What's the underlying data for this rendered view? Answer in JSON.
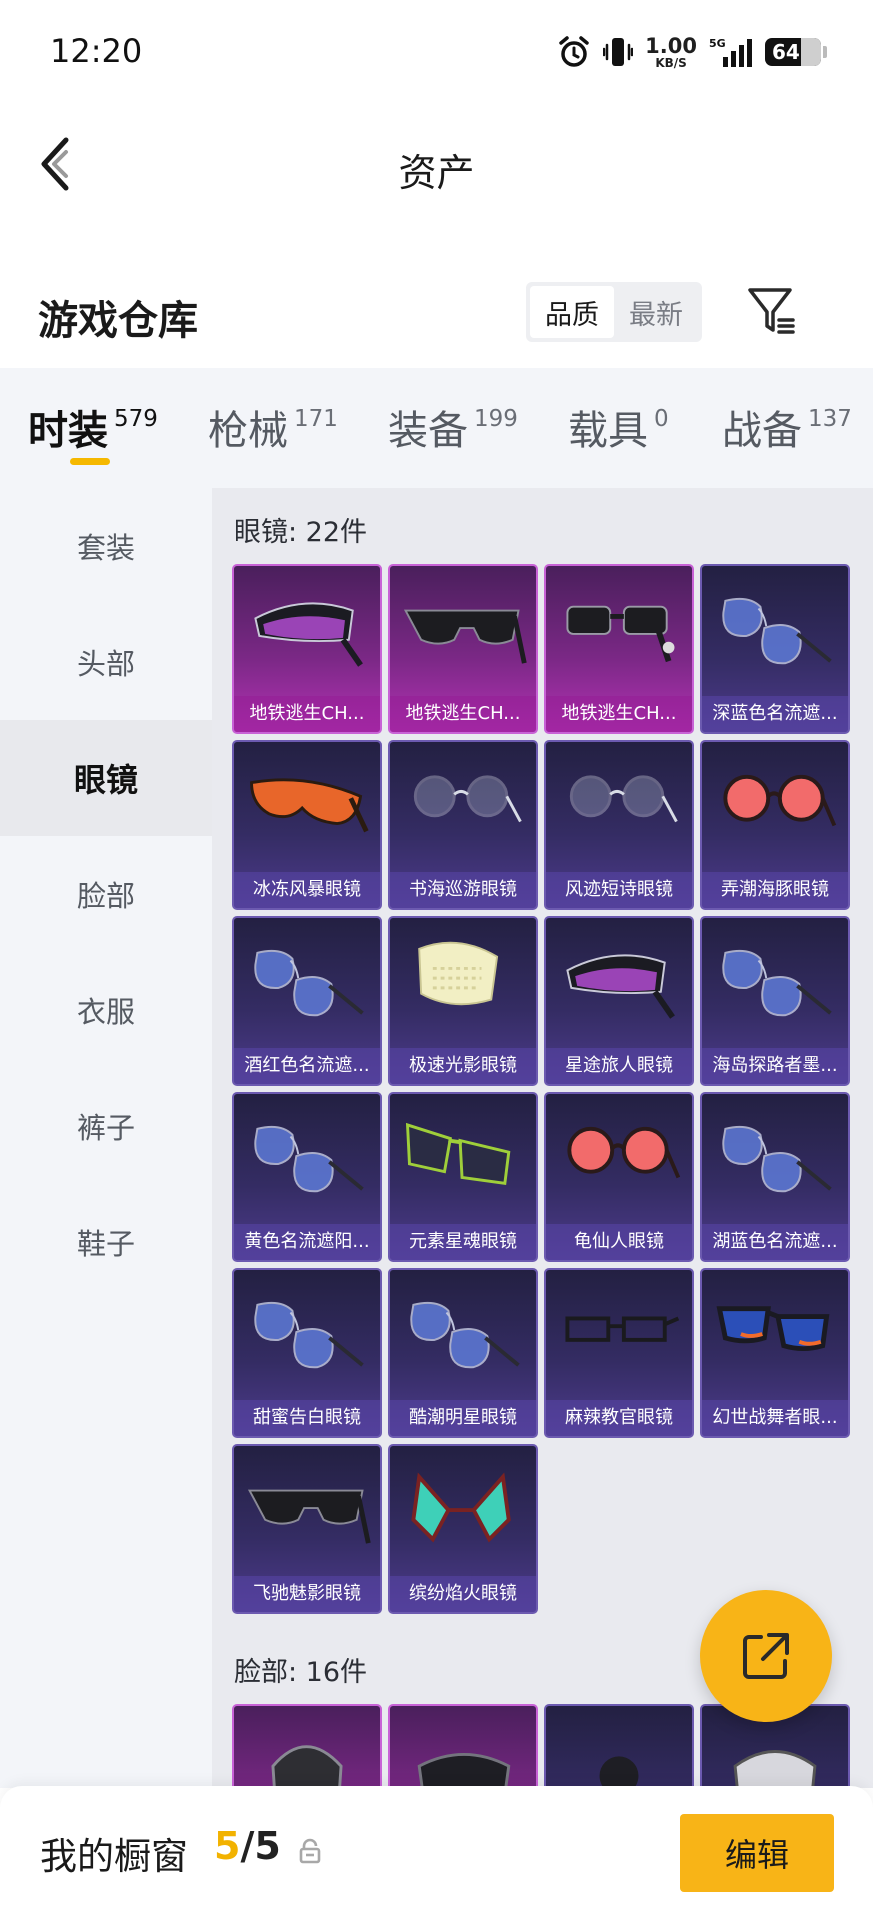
{
  "status_bar": {
    "time": "12:20",
    "net_speed_value": "1.00",
    "net_speed_unit": "KB/S",
    "network_type": "5G",
    "battery": "64"
  },
  "header": {
    "title": "资产"
  },
  "warehouse": {
    "title": "游戏仓库",
    "sort_options": [
      "品质",
      "最新"
    ],
    "active_sort": "品质"
  },
  "categories": [
    {
      "label": "时装",
      "count": "579",
      "active": true
    },
    {
      "label": "枪械",
      "count": "171",
      "active": false
    },
    {
      "label": "装备",
      "count": "199",
      "active": false
    },
    {
      "label": "载具",
      "count": "0",
      "active": false
    },
    {
      "label": "战备",
      "count": "137",
      "active": false
    }
  ],
  "sidebar": {
    "items": [
      "套装",
      "头部",
      "眼镜",
      "脸部",
      "衣服",
      "裤子",
      "鞋子"
    ],
    "active": "眼镜"
  },
  "sections": [
    {
      "title": "眼镜: 22件",
      "items": [
        {
          "name": "地铁逃生CH...",
          "rarity": "pink",
          "icon": "visor-glasses-icon"
        },
        {
          "name": "地铁逃生CH...",
          "rarity": "pink",
          "icon": "shield-sunglasses-icon"
        },
        {
          "name": "地铁逃生CH...",
          "rarity": "pink",
          "icon": "tech-glasses-icon"
        },
        {
          "name": "深蓝色名流遮...",
          "rarity": "blue",
          "icon": "aviator-glasses-icon"
        },
        {
          "name": "冰冻风暴眼镜",
          "rarity": "blue",
          "icon": "wrap-sunglasses-icon"
        },
        {
          "name": "书海巡游眼镜",
          "rarity": "blue",
          "icon": "round-glasses-icon"
        },
        {
          "name": "风迹短诗眼镜",
          "rarity": "blue",
          "icon": "round-glasses-icon"
        },
        {
          "name": "弄潮海豚眼镜",
          "rarity": "blue",
          "icon": "round-sunglasses-icon"
        },
        {
          "name": "酒红色名流遮...",
          "rarity": "blue",
          "icon": "aviator-glasses-icon"
        },
        {
          "name": "极速光影眼镜",
          "rarity": "blue",
          "icon": "mesh-visor-icon"
        },
        {
          "name": "星途旅人眼镜",
          "rarity": "blue",
          "icon": "visor-glasses-icon"
        },
        {
          "name": "海岛探路者墨...",
          "rarity": "blue",
          "icon": "aviator-glasses-icon"
        },
        {
          "name": "黄色名流遮阳...",
          "rarity": "blue",
          "icon": "aviator-glasses-icon"
        },
        {
          "name": "元素星魂眼镜",
          "rarity": "blue",
          "icon": "angular-sunglasses-icon"
        },
        {
          "name": "龟仙人眼镜",
          "rarity": "blue",
          "icon": "round-sunglasses-icon"
        },
        {
          "name": "湖蓝色名流遮...",
          "rarity": "blue",
          "icon": "aviator-glasses-icon"
        },
        {
          "name": "甜蜜告白眼镜",
          "rarity": "blue",
          "icon": "aviator-glasses-icon"
        },
        {
          "name": "酷潮明星眼镜",
          "rarity": "blue",
          "icon": "aviator-glasses-icon"
        },
        {
          "name": "麻辣教官眼镜",
          "rarity": "blue",
          "icon": "rectangle-glasses-icon"
        },
        {
          "name": "幻世战舞者眼...",
          "rarity": "blue",
          "icon": "wayfarer-sunglasses-icon"
        },
        {
          "name": "飞驰魅影眼镜",
          "rarity": "blue",
          "icon": "shield-sunglasses-icon"
        },
        {
          "name": "缤纷焰火眼镜",
          "rarity": "blue",
          "icon": "star-glasses-icon"
        }
      ]
    },
    {
      "title": "脸部: 16件",
      "items": [
        {
          "name": "",
          "rarity": "pink",
          "icon": "gas-mask-icon"
        },
        {
          "name": "",
          "rarity": "pink",
          "icon": "face-mask-icon"
        },
        {
          "name": "",
          "rarity": "blue",
          "icon": "mask-icon"
        },
        {
          "name": "",
          "rarity": "blue",
          "icon": "respirator-icon"
        }
      ]
    }
  ],
  "showcase": {
    "label": "我的橱窗",
    "current": "5",
    "separator": "/",
    "total": "5",
    "edit_label": "编辑"
  }
}
